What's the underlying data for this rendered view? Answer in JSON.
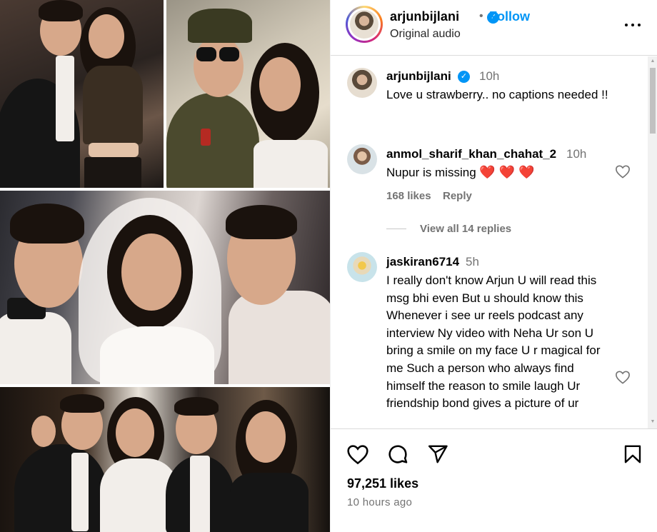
{
  "post": {
    "username": "arjunbijlani",
    "follow_label": "Follow",
    "audio_label": "Original audio",
    "more_label": "More options"
  },
  "comments": [
    {
      "username": "arjunbijlani",
      "time": "10h",
      "text": "Love u strawberry.. no captions needed !!",
      "verified": true
    },
    {
      "username": "anmol_sharif_khan_chahat_2",
      "time": "10h",
      "text": "Nupur is missing",
      "emoji": "❤️ ❤️ ❤️",
      "likes": "168 likes",
      "reply_label": "Reply",
      "view_replies": "View all 14 replies"
    },
    {
      "username": "jaskiran6714",
      "time": "5h",
      "text": "I really don't know Arjun U will read this msg bhi even But u should know this Whenever i see ur reels podcast any interview Ny video with Neha Ur son U bring a smile on my face U r magical for me Such a person who always find himself the reason to smile laugh Ur friendship bond gives a picture of ur"
    }
  ],
  "footer": {
    "likes": "97,251 likes",
    "time_ago": "10 hours ago"
  },
  "icons": {
    "like": "heart-icon",
    "comment": "comment-icon",
    "share": "share-icon",
    "save": "bookmark-icon",
    "more": "more-icon"
  },
  "colors": {
    "accent": "#0095f6",
    "muted": "#737373",
    "border": "#dbdbdb",
    "heart": "#e0245e"
  }
}
